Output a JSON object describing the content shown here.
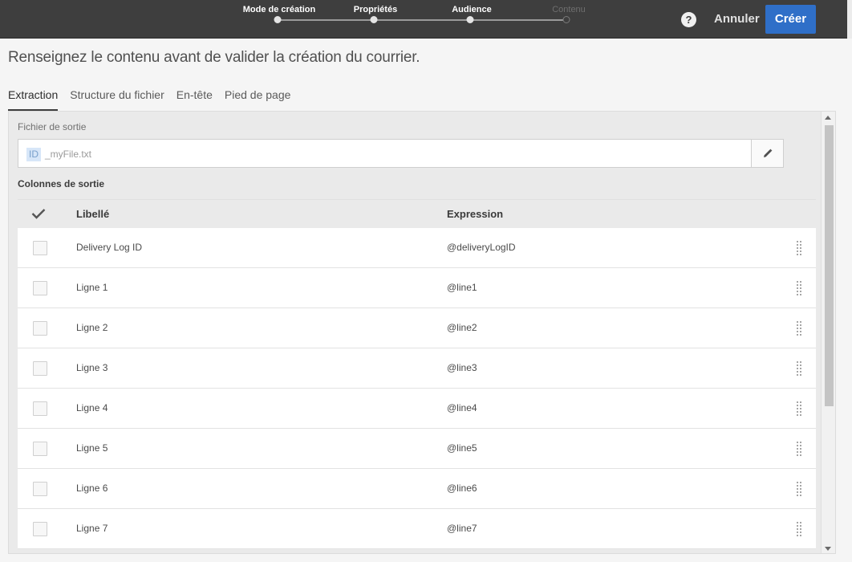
{
  "wizard": {
    "steps": [
      {
        "label": "Mode de création",
        "state": "done"
      },
      {
        "label": "Propriétés",
        "state": "done"
      },
      {
        "label": "Audience",
        "state": "done"
      },
      {
        "label": "Contenu",
        "state": "inactive"
      }
    ],
    "help_icon": "question-icon",
    "cancel_label": "Annuler",
    "create_label": "Créer"
  },
  "page": {
    "title": "Renseignez le contenu avant de valider la création du courrier."
  },
  "tabs": [
    {
      "label": "Extraction",
      "active": true
    },
    {
      "label": "Structure du fichier",
      "active": false
    },
    {
      "label": "En-tête",
      "active": false
    },
    {
      "label": "Pied de page",
      "active": false
    }
  ],
  "extraction": {
    "output_file_label": "Fichier de sortie",
    "file_chip": "ID",
    "file_name": "_myFile.txt",
    "edit_icon": "pencil-icon",
    "columns_label": "Colonnes de sortie",
    "table": {
      "headers": {
        "label": "Libellé",
        "expression": "Expression"
      },
      "rows": [
        {
          "label": "Delivery Log ID",
          "expression": "@deliveryLogID"
        },
        {
          "label": "Ligne 1",
          "expression": "@line1"
        },
        {
          "label": "Ligne 2",
          "expression": "@line2"
        },
        {
          "label": "Ligne 3",
          "expression": "@line3"
        },
        {
          "label": "Ligne 4",
          "expression": "@line4"
        },
        {
          "label": "Ligne 5",
          "expression": "@line5"
        },
        {
          "label": "Ligne 6",
          "expression": "@line6"
        },
        {
          "label": "Ligne 7",
          "expression": "@line7"
        }
      ]
    }
  },
  "colors": {
    "topbar": "#3e3e3e",
    "primary": "#2f6fc8",
    "background": "#f5f5f5"
  }
}
